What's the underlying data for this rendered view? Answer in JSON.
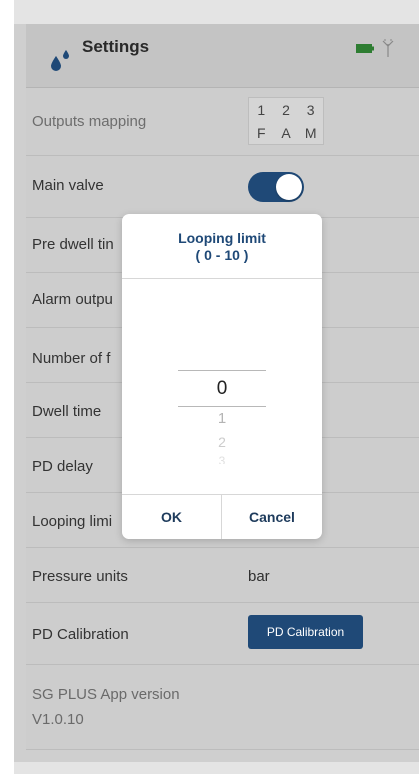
{
  "header": {
    "title": "Settings",
    "icon": "water-drops-icon",
    "status_icons": [
      "battery-icon",
      "antenna-icon"
    ],
    "accent_color": "#1f4977"
  },
  "outputs_mapping": {
    "label": "Outputs mapping",
    "numbers": [
      "1",
      "2",
      "3"
    ],
    "letters": [
      "F",
      "A",
      "M"
    ]
  },
  "rows": {
    "main_valve": "Main valve",
    "pre_dwell": "Pre dwell tin",
    "alarm_output": "Alarm outpu",
    "number_of": "Number of f",
    "dwell_time": "Dwell time",
    "pd_delay": "PD delay",
    "looping_limit": "Looping limi",
    "pressure_units": "Pressure units",
    "pd_calibration": "PD Calibration"
  },
  "values": {
    "main_valve_on": true,
    "pressure_units": "bar",
    "pd_calibration_button": "PD Calibration"
  },
  "version": {
    "line1": "SG PLUS App version",
    "line2": "V1.0.10"
  },
  "dialog": {
    "title_line1": "Looping limit",
    "title_line2": "( 0 - 10 )",
    "picker": {
      "selected": "0",
      "next": [
        "1",
        "2",
        "3"
      ]
    },
    "ok": "OK",
    "cancel": "Cancel"
  }
}
